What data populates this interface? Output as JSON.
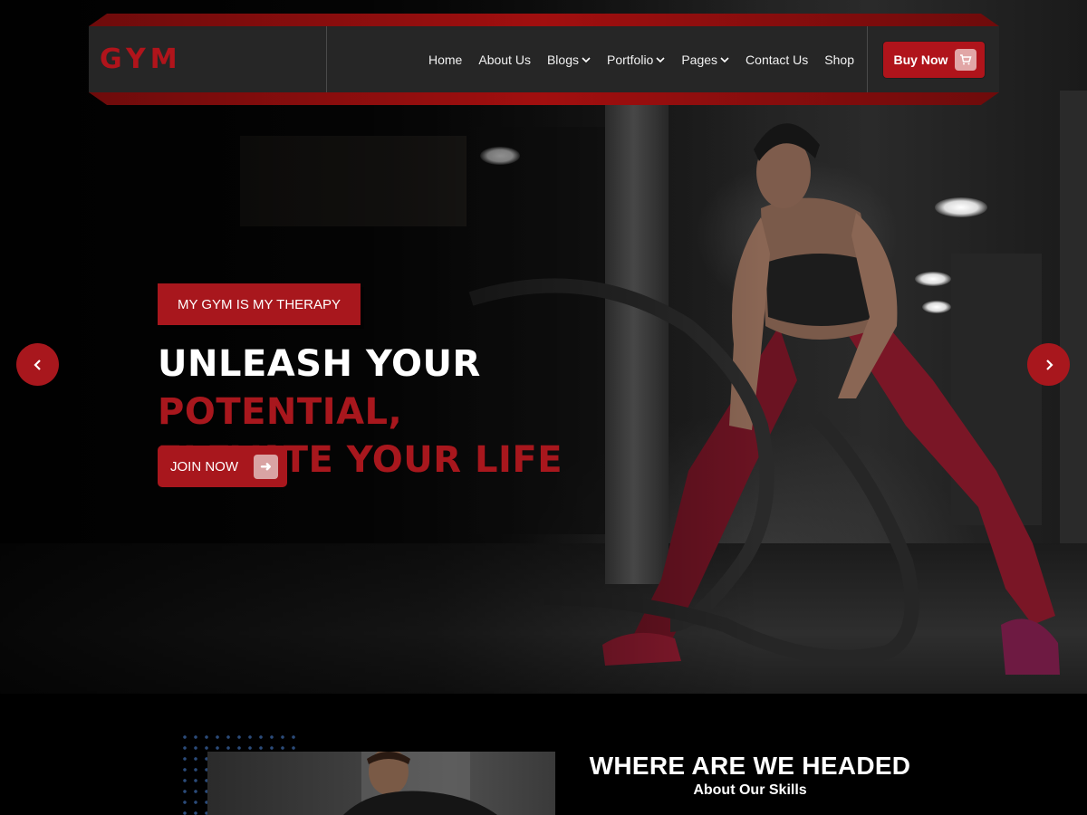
{
  "brand": {
    "logo": "GYM",
    "accent_color": "#a8171d"
  },
  "nav": {
    "items": [
      {
        "label": "Home",
        "has_dropdown": false
      },
      {
        "label": "About Us",
        "has_dropdown": false
      },
      {
        "label": "Blogs",
        "has_dropdown": true
      },
      {
        "label": "Portfolio",
        "has_dropdown": true
      },
      {
        "label": "Pages",
        "has_dropdown": true
      },
      {
        "label": "Contact Us",
        "has_dropdown": false
      },
      {
        "label": "Shop",
        "has_dropdown": false
      }
    ],
    "buy_button": {
      "label": "Buy Now",
      "icon": "cart-icon"
    },
    "dropdown_icon": "chevron-down-icon"
  },
  "hero": {
    "tagline": "MY GYM IS MY THERAPY",
    "headline_part1": "UNLEASH YOUR ",
    "headline_part2": "POTENTIAL,",
    "headline_line2": "ELEVATE YOUR LIFE",
    "cta": {
      "label": "JOIN NOW",
      "icon": "arrow-right-icon"
    },
    "prev_icon": "chevron-left-icon",
    "next_icon": "chevron-right-icon"
  },
  "about": {
    "title": "WHERE ARE WE HEADED",
    "subtitle": "About Our Skills"
  }
}
